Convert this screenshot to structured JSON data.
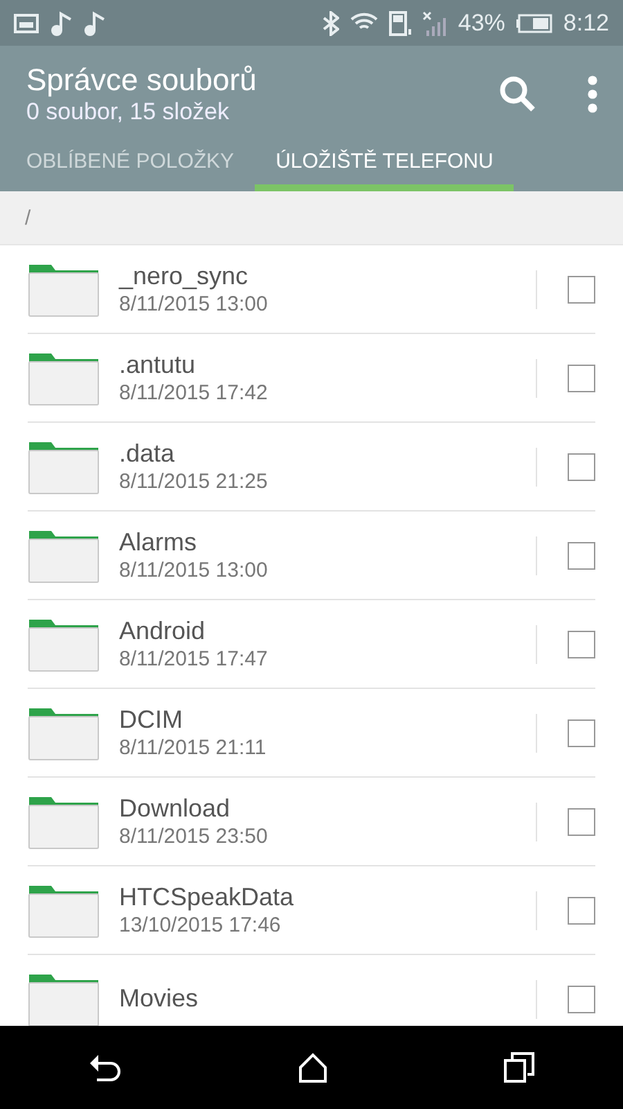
{
  "status_bar": {
    "battery": "43%",
    "time": "8:12"
  },
  "app_bar": {
    "title": "Správce souborů",
    "subtitle": "0 soubor, 15 složek"
  },
  "tabs": [
    {
      "label": "OBLÍBENÉ POLOŽKY",
      "selected": false
    },
    {
      "label": "ÚLOŽIŠTĚ TELEFONU",
      "selected": true
    }
  ],
  "path": "/",
  "files": [
    {
      "name": "_nero_sync",
      "date": "8/11/2015 13:00",
      "checked": false
    },
    {
      "name": ".antutu",
      "date": "8/11/2015 17:42",
      "checked": false
    },
    {
      "name": ".data",
      "date": "8/11/2015 21:25",
      "checked": false
    },
    {
      "name": "Alarms",
      "date": "8/11/2015 13:00",
      "checked": false
    },
    {
      "name": "Android",
      "date": "8/11/2015 17:47",
      "checked": false
    },
    {
      "name": "DCIM",
      "date": "8/11/2015 21:11",
      "checked": false
    },
    {
      "name": "Download",
      "date": "8/11/2015 23:50",
      "checked": false
    },
    {
      "name": "HTCSpeakData",
      "date": "13/10/2015 17:46",
      "checked": false
    },
    {
      "name": "Movies",
      "checked": false
    }
  ]
}
